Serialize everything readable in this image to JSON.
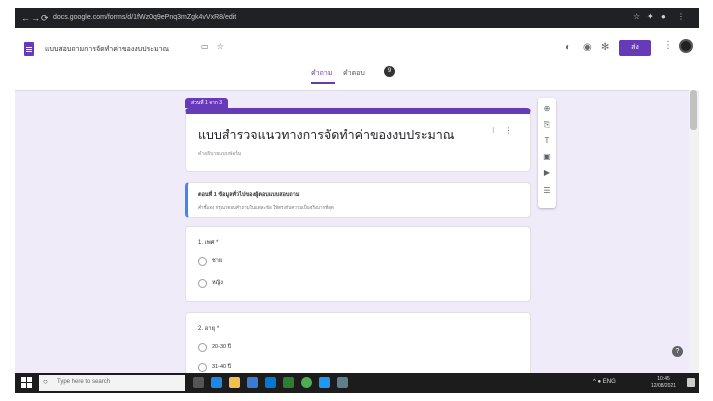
{
  "browser": {
    "url": "docs.google.com/forms/d/1fWz0q9ePnq3mZgk4vVxR8/edit",
    "back": "←",
    "forward": "→",
    "reload": "⟳"
  },
  "header": {
    "form_title": "แบบสอบถามการจัดทำค่าของงบประมาณ",
    "send_label": "ส่ง",
    "avatar_color": "#222222"
  },
  "tabs": {
    "questions": "คำถาม",
    "responses": "คำตอบ",
    "responses_count": "9"
  },
  "form": {
    "section_tag": "ส่วนที่ 1 จาก 3",
    "title": "แบบสำรวจแนวทางการจัดทำค่าของงบประมาณ",
    "description": "คำอธิบายแบบฟอร์ม",
    "section": {
      "title": "ตอนที่ 1 ข้อมูลทั่วไปของผู้ตอบแบบสอบถาม",
      "description": "คำชี้แจง กรุณาตอบคำถามในแต่ละข้อ ให้ตรงกับความเป็นจริงมากที่สุด"
    },
    "questions": [
      {
        "label": "1. เพศ *",
        "options": [
          "ชาย",
          "หญิง"
        ]
      },
      {
        "label": "2. อายุ *",
        "options": [
          "20-30 ปี",
          "31-40 ปี"
        ]
      }
    ]
  },
  "taskbar": {
    "search_placeholder": "Type here to search",
    "tray_text": "^ ● ENG",
    "time": "10:45",
    "date": "12/08/2021"
  },
  "colors": {
    "accent": "#673ab7",
    "background": "#f0ebf8",
    "section_border": "#4285f4"
  }
}
